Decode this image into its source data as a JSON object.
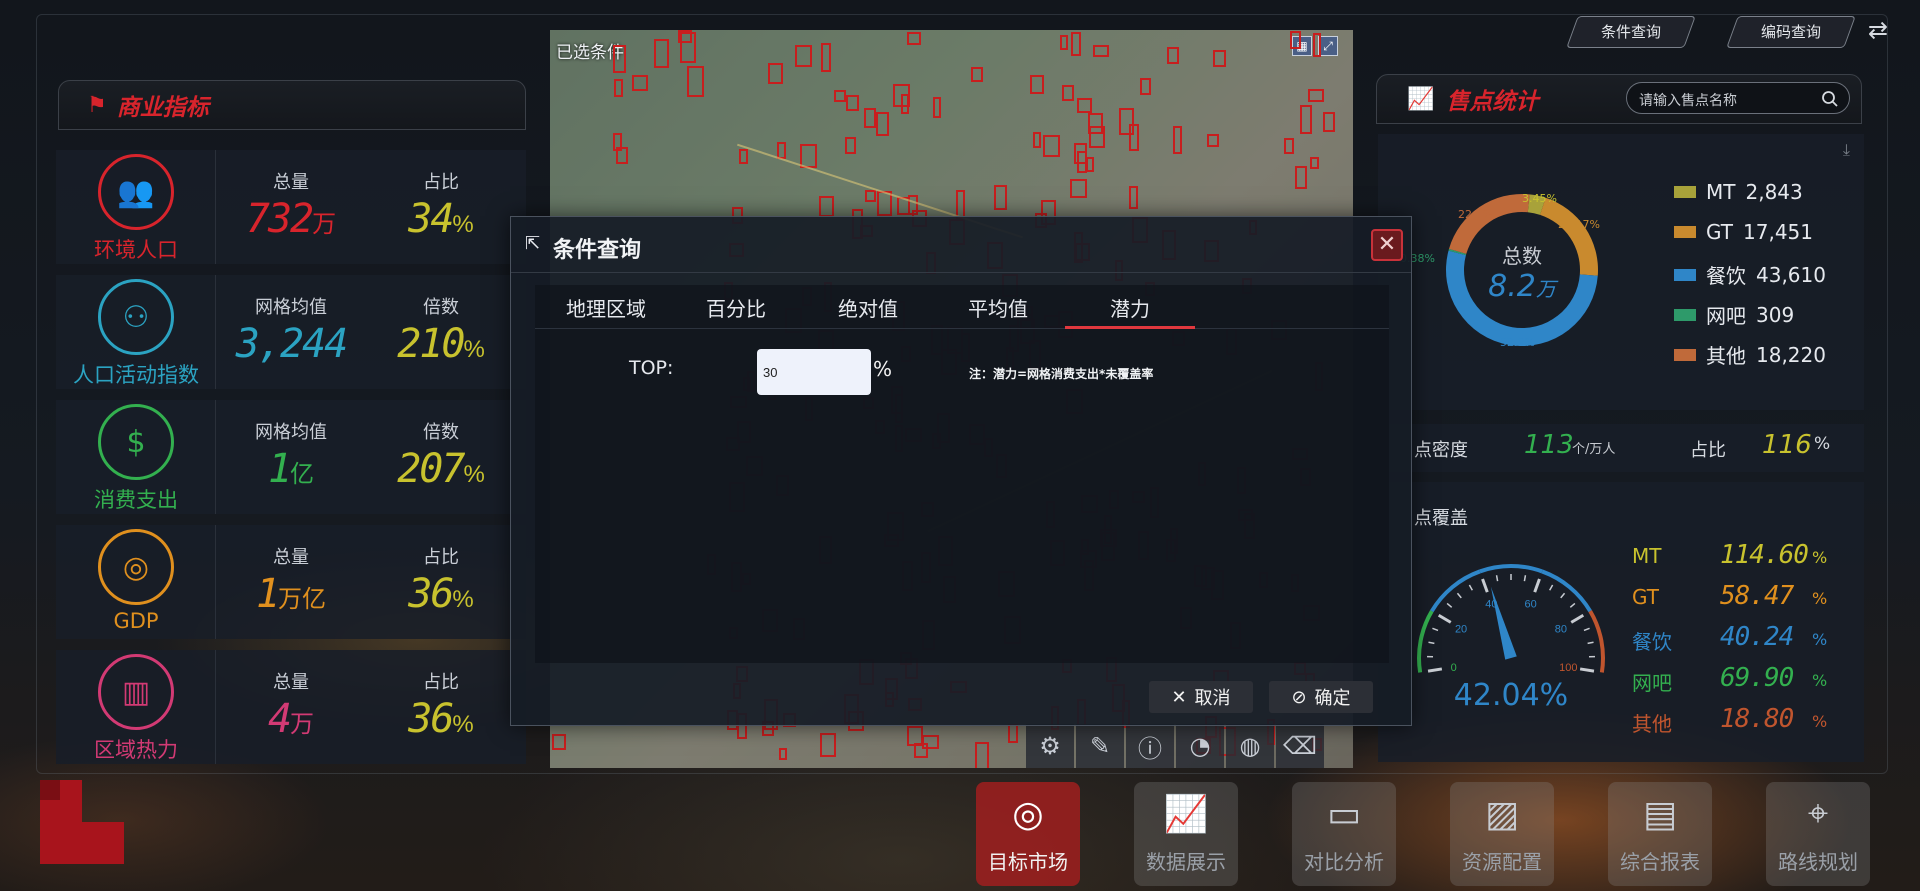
{
  "left_panel": {
    "title": "商业指标",
    "rows": [
      {
        "name": "环境人口",
        "icon": "people-group-icon",
        "color": "#d8242c",
        "c1_label": "总量",
        "c1_value": "732",
        "c1_unit": "万",
        "c2_label": "占比",
        "c2_value": "34",
        "c2_unit": "%"
      },
      {
        "name": "人口活动指数",
        "icon": "people-network-icon",
        "color": "#2ba3c2",
        "c1_label": "网格均值",
        "c1_value": "3,244",
        "c1_unit": "",
        "c2_label": "倍数",
        "c2_value": "210",
        "c2_unit": "%"
      },
      {
        "name": "消费支出",
        "icon": "hand-money-icon",
        "color": "#33b04f",
        "c1_label": "网格均值",
        "c1_value": "1",
        "c1_unit": "亿",
        "c2_label": "倍数",
        "c2_value": "207",
        "c2_unit": "%"
      },
      {
        "name": "GDP",
        "icon": "coins-stack-icon",
        "color": "#e0901e",
        "c1_label": "总量",
        "c1_value": "1",
        "c1_unit": "万亿",
        "c2_label": "占比",
        "c2_value": "36",
        "c2_unit": "%"
      },
      {
        "name": "区域热力",
        "icon": "bar-chart-icon",
        "color": "#d23a74",
        "c1_label": "总量",
        "c1_value": "4",
        "c1_unit": "万",
        "c2_label": "占比",
        "c2_value": "36",
        "c2_unit": "%"
      }
    ],
    "value2_color": "#c8c22e"
  },
  "map": {
    "label": "已选条件"
  },
  "top_buttons": {
    "condition_query": "条件查询",
    "code_query": "编码查询"
  },
  "right_panel": {
    "title": "售点统计",
    "search_placeholder": "请输入售点名称",
    "donut": {
      "center_label": "总数",
      "center_value": "8.2",
      "center_unit": "万",
      "pct_labels": [
        "3.45%",
        "21.17%",
        "52.9%",
        "0.38%",
        "22.1%"
      ]
    },
    "legend": [
      {
        "name": "MT",
        "value": "2,843",
        "color": "#a8a23a"
      },
      {
        "name": "GT",
        "value": "17,451",
        "color": "#c98a2e"
      },
      {
        "name": "餐饮",
        "value": "43,610",
        "color": "#2f86c8"
      },
      {
        "name": "网吧",
        "value": "309",
        "color": "#2e9a6a"
      },
      {
        "name": "其他",
        "value": "18,220",
        "color": "#c06a3a"
      }
    ],
    "density": {
      "label": "点密度",
      "value": "113",
      "unit": "个/万人",
      "ratio_label": "占比",
      "ratio_value": "116",
      "ratio_unit": "%"
    },
    "coverage": {
      "label": "点覆盖",
      "gauge_value": "42.04%",
      "gauge_level": 42.04,
      "gauge_ticks": [
        "0",
        "20",
        "40",
        "60",
        "80",
        "100"
      ],
      "rows": [
        {
          "name": "MT",
          "value": "114.60",
          "pct": "%",
          "color": "#c8c22e"
        },
        {
          "name": "GT",
          "value": "58.47",
          "pct": "%",
          "color": "#e0901e"
        },
        {
          "name": "餐饮",
          "value": "40.24",
          "pct": "%",
          "color": "#2f86c8"
        },
        {
          "name": "网吧",
          "value": "69.90",
          "pct": "%",
          "color": "#33b04f"
        },
        {
          "name": "其他",
          "value": "18.80",
          "pct": "%",
          "color": "#c0552e"
        }
      ]
    }
  },
  "bottom_nav": [
    {
      "label": "目标市场",
      "icon": "target-arrow-icon",
      "active": true
    },
    {
      "label": "数据展示",
      "icon": "line-chart-icon",
      "active": false
    },
    {
      "label": "对比分析",
      "icon": "presentation-board-icon",
      "active": false
    },
    {
      "label": "资源配置",
      "icon": "resource-chart-icon",
      "active": false
    },
    {
      "label": "综合报表",
      "icon": "report-document-icon",
      "active": false
    },
    {
      "label": "路线规划",
      "icon": "route-pin-icon",
      "active": false
    }
  ],
  "modal": {
    "title": "条件查询",
    "tabs": [
      "地理区域",
      "百分比",
      "绝对值",
      "平均值",
      "潜力"
    ],
    "active_tab": "潜力",
    "top_label": "TOP:",
    "top_value": "30",
    "top_unit": "%",
    "note": "注：潜力=网格消费支出*未覆盖率",
    "cancel_label": "取消",
    "confirm_label": "确定"
  }
}
